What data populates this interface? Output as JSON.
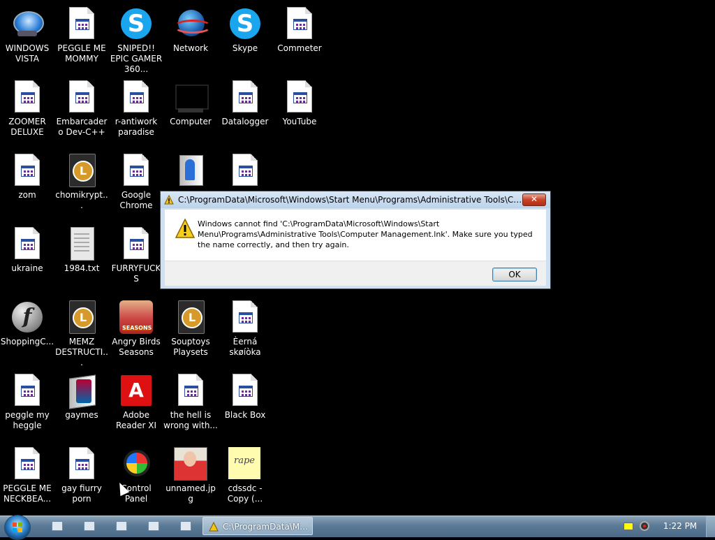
{
  "desktop": {
    "icons": [
      {
        "label": "WINDOWS VISTA",
        "icon": "vista-orb-icon"
      },
      {
        "label": "PEGGLE ME MOMMY",
        "icon": "document-icon"
      },
      {
        "label": "SNIPED!! EPIC GAMER 360...",
        "icon": "skype-icon"
      },
      {
        "label": "Network",
        "icon": "network-icon"
      },
      {
        "label": "Skype",
        "icon": "skype-icon"
      },
      {
        "label": "Commeter",
        "icon": "document-icon"
      },
      {
        "label": "ZOOMER DELUXE",
        "icon": "document-icon"
      },
      {
        "label": "Embarcadero Dev-C++",
        "icon": "document-icon"
      },
      {
        "label": "r-antiwork paradise",
        "icon": "document-icon"
      },
      {
        "label": "Computer",
        "icon": "computer-icon"
      },
      {
        "label": "Datalogger",
        "icon": "document-icon"
      },
      {
        "label": "YouTube",
        "icon": "document-icon"
      },
      {
        "label": "zom",
        "icon": "document-icon"
      },
      {
        "label": "chomikrypt...",
        "icon": "media-file-icon"
      },
      {
        "label": "Google Chrome",
        "icon": "document-icon"
      },
      {
        "label": "ukraine",
        "icon": "document-icon"
      },
      {
        "label": "1984.txt",
        "icon": "text-file-icon"
      },
      {
        "label": "FURRYFUCKS",
        "icon": "document-icon"
      },
      {
        "label": "ShoppingC...",
        "icon": "flash-icon"
      },
      {
        "label": "MEMZ DESTRUCTI...",
        "icon": "media-file-icon"
      },
      {
        "label": "Angry Birds Seasons",
        "icon": "angry-birds-icon"
      },
      {
        "label": "Souptoys Playsets",
        "icon": "media-file-icon"
      },
      {
        "label": "Èerná skøíòka",
        "icon": "document-icon"
      },
      {
        "label": "peggle my heggle",
        "icon": "document-icon"
      },
      {
        "label": "gaymes",
        "icon": "folder-icon"
      },
      {
        "label": "Adobe Reader XI",
        "icon": "adobe-reader-icon"
      },
      {
        "label": "the hell is wrong with...",
        "icon": "document-icon"
      },
      {
        "label": "Black Box",
        "icon": "document-icon"
      },
      {
        "label": "PEGGLE ME NECKBEA...",
        "icon": "document-icon"
      },
      {
        "label": "gay fiurry porn",
        "icon": "document-icon"
      },
      {
        "label": "Control Panel",
        "icon": "control-panel-icon"
      },
      {
        "label": "unnamed.jpg",
        "icon": "photo-icon"
      },
      {
        "label": "cdssdc - Copy (...",
        "icon": "sticky-note-icon"
      }
    ]
  },
  "dialog": {
    "title": "C:\\ProgramData\\Microsoft\\Windows\\Start Menu\\Programs\\Administrative Tools\\Computer...",
    "message": "Windows cannot find 'C:\\ProgramData\\Microsoft\\Windows\\Start Menu\\Programs\\Administrative Tools\\Computer Management.lnk'. Make sure you typed the name correctly, and then try again.",
    "ok_label": "OK",
    "close_label": "✕"
  },
  "taskbar": {
    "task_label": "C:\\ProgramData\\Mic...",
    "clock": "1:22 PM"
  },
  "colors": {
    "desktop_bg": "#000000",
    "dialog_frame": "#cfe0f1",
    "close_button": "#c7442a",
    "ok_border": "#3c7fb1"
  }
}
